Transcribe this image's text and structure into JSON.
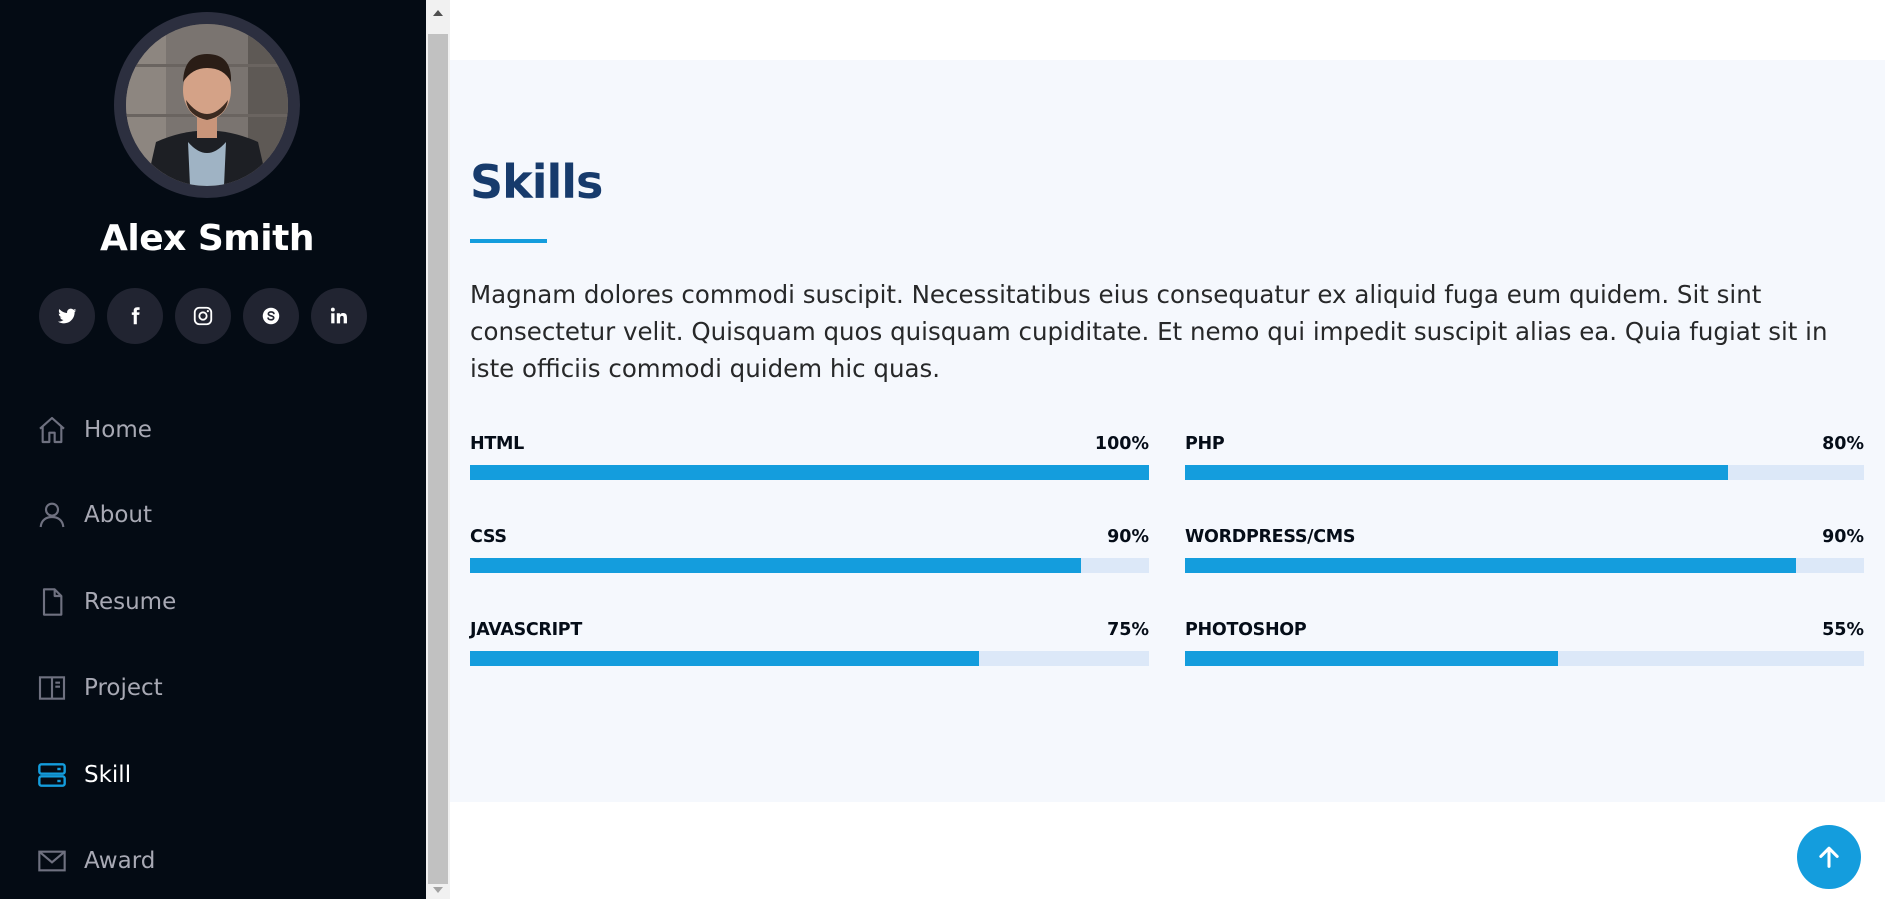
{
  "profile": {
    "name": "Alex Smith"
  },
  "social": [
    {
      "icon": "twitter-icon"
    },
    {
      "icon": "facebook-icon"
    },
    {
      "icon": "instagram-icon"
    },
    {
      "icon": "skype-icon"
    },
    {
      "icon": "linkedin-icon"
    }
  ],
  "nav": {
    "items": [
      {
        "label": "Home",
        "icon": "home-icon",
        "active": false
      },
      {
        "label": "About",
        "icon": "person-icon",
        "active": false
      },
      {
        "label": "Resume",
        "icon": "file-icon",
        "active": false
      },
      {
        "label": "Project",
        "icon": "book-icon",
        "active": false
      },
      {
        "label": "Skill",
        "icon": "server-icon",
        "active": true
      },
      {
        "label": "Award",
        "icon": "envelope-icon",
        "active": false
      }
    ]
  },
  "skills_section": {
    "title": "Skills",
    "description": "Magnam dolores commodi suscipit. Necessitatibus eius consequatur ex aliquid fuga eum quidem. Sit sint consectetur velit. Quisquam quos quisquam cupiditate. Et nemo qui impedit suscipit alias ea. Quia fugiat sit in iste officiis commodi quidem hic quas.",
    "skills": [
      {
        "name": "HTML",
        "value_label": "100%",
        "percent": 100
      },
      {
        "name": "PHP",
        "value_label": "80%",
        "percent": 80
      },
      {
        "name": "CSS",
        "value_label": "90%",
        "percent": 90
      },
      {
        "name": "WORDPRESS/CMS",
        "value_label": "90%",
        "percent": 90
      },
      {
        "name": "JAVASCRIPT",
        "value_label": "75%",
        "percent": 75
      },
      {
        "name": "PHOTOSHOP",
        "value_label": "55%",
        "percent": 55
      }
    ]
  },
  "colors": {
    "accent": "#149ddd",
    "sidebar_bg": "#040b14",
    "title": "#173b6c",
    "track": "#dce8f8"
  }
}
